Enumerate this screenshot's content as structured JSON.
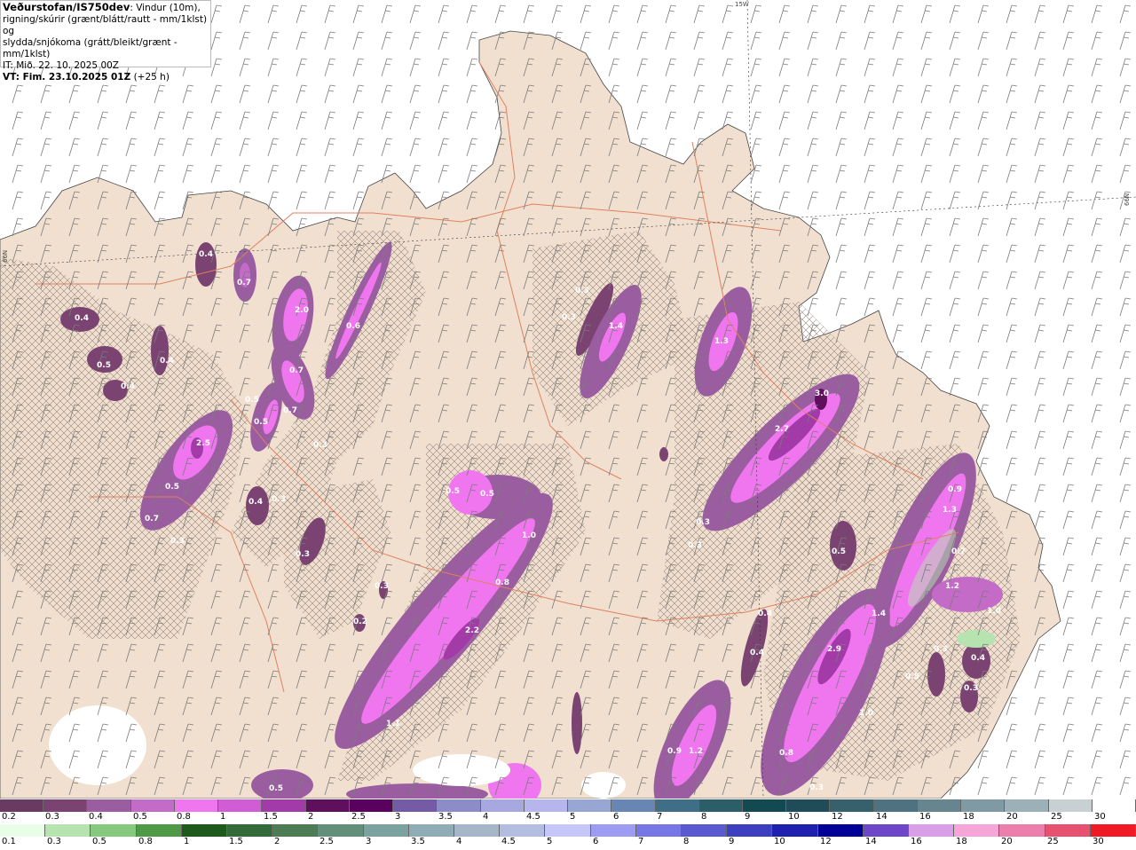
{
  "header": {
    "title": "Veðurstofan/IS750dev",
    "title_suffix": ": Vindur (10m),",
    "line2": "rigning/skúrir (grænt/blátt/rautt - mm/1klst) og",
    "line3": "slydda/snjókoma (grátt/bleikt/grænt - mm/1klst)",
    "it_line": "IT: Mið. 22. 10. 2025 00Z",
    "vt_prefix": "VT: Fim. 23.10.2025 01Z",
    "vt_suffix": " (+25 h)"
  },
  "coords": {
    "lon": "15W",
    "lat_left": "66N",
    "lat_right": "66N"
  },
  "map_labels": [
    "0.4",
    "0.7",
    "2.0",
    "0.7",
    "0.6",
    "0.4",
    "0.5",
    "0.4",
    "0.4",
    "0.3",
    "0.3",
    "1.4",
    "1.3",
    "0.5",
    "2.5",
    "0.5",
    "0.7",
    "0.7",
    "0.5",
    "3.0",
    "2.7",
    "0.3",
    "0.5",
    "0.5",
    "0.4",
    "0.3",
    "0.3",
    "0.3",
    "1.0",
    "0.8",
    "0.2",
    "0.3",
    "0.9",
    "1.3",
    "0.7",
    "0.5",
    "1.2",
    "1.0",
    "1.4",
    "0.4",
    "0.4",
    "2.9",
    "0.3",
    "0.4",
    "0.5",
    "2.2",
    "0.3",
    "1.0",
    "1.1",
    "0.9",
    "1.2",
    "0.8",
    "0.3",
    "0.5",
    "0.3",
    "0.3"
  ],
  "legend_snow": {
    "labels": [
      "0.2",
      "0.3",
      "0.4",
      "0.5",
      "0.8",
      "1",
      "1.5",
      "2",
      "2.5",
      "3",
      "3.5",
      "4",
      "4.5",
      "5",
      "6",
      "7",
      "8",
      "9",
      "10",
      "12",
      "14",
      "16",
      "18",
      "20",
      "25",
      "30"
    ],
    "colors": [
      "#6b3a63",
      "#7a4372",
      "#9a5ea0",
      "#c46bc8",
      "#ef76ee",
      "#d25cd6",
      "#a23aa8",
      "#5f0f5b",
      "#5a005f",
      "#755aa6",
      "#8c8cc8",
      "#a8a8e0",
      "#b6b6ec",
      "#98a6d4",
      "#6886b4",
      "#3f6f86",
      "#2b5e69",
      "#134a52",
      "#204c5a",
      "#36606c",
      "#4e7280",
      "#67858f",
      "#7f9aa3",
      "#9cb0b7",
      "#c8d0d4",
      "#ffffff"
    ]
  },
  "legend_rain": {
    "labels": [
      "0.1",
      "0.3",
      "0.5",
      "0.8",
      "1",
      "1.5",
      "2",
      "2.5",
      "3",
      "3.5",
      "4",
      "4.5",
      "5",
      "6",
      "7",
      "8",
      "9",
      "10",
      "12",
      "14",
      "16",
      "18",
      "20",
      "25",
      "30"
    ],
    "colors": [
      "#e6ffe6",
      "#b6e3b0",
      "#86c87e",
      "#4f9a46",
      "#1e5a1c",
      "#336a3a",
      "#4e7d55",
      "#62907a",
      "#7ca2a0",
      "#90adb6",
      "#a4b6c8",
      "#b3bde0",
      "#c6c6f8",
      "#9c9cf2",
      "#7676e6",
      "#5a5ad0",
      "#3e3ec0",
      "#2020b0",
      "#000099",
      "#6e46c8",
      "#d99ee8",
      "#f5a5d8",
      "#ec7eac",
      "#e85070",
      "#ef1a24"
    ]
  }
}
